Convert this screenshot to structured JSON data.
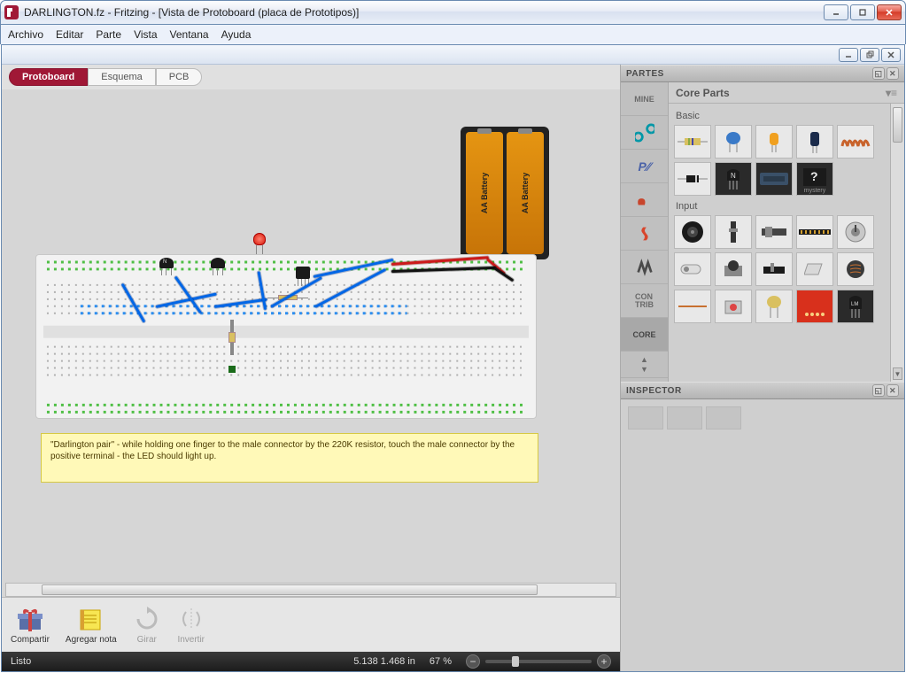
{
  "window": {
    "title": "DARLINGTON.fz - Fritzing - [Vista de Protoboard (placa de Prototipos)]"
  },
  "menu": {
    "items": [
      "Archivo",
      "Editar",
      "Parte",
      "Vista",
      "Ventana",
      "Ayuda"
    ]
  },
  "viewtabs": {
    "items": [
      {
        "label": "Protoboard",
        "active": true
      },
      {
        "label": "Esquema",
        "active": false
      },
      {
        "label": "PCB",
        "active": false
      }
    ]
  },
  "note": {
    "text": "\"Darlington pair\" - while holding one finger to the male connector by the 220K resistor, touch the male connector by the positive terminal - the LED should light up."
  },
  "battery": {
    "cell_label": "AA Battery"
  },
  "toolbar": {
    "compartir": "Compartir",
    "agregar_nota": "Agregar nota",
    "girar": "Girar",
    "invertir": "Invertir"
  },
  "status": {
    "ready": "Listo",
    "coords": "5.138 1.468 in",
    "zoom": "67 %"
  },
  "parts": {
    "header": "PARTES",
    "bin_title": "Core Parts",
    "bins": {
      "mine": "MINE",
      "contrib": "CON\nTRIB",
      "core": "CORE"
    },
    "sections": {
      "basic": "Basic",
      "input": "Input"
    },
    "mystery_label": "mystery"
  },
  "inspector": {
    "header": "INSPECTOR"
  }
}
